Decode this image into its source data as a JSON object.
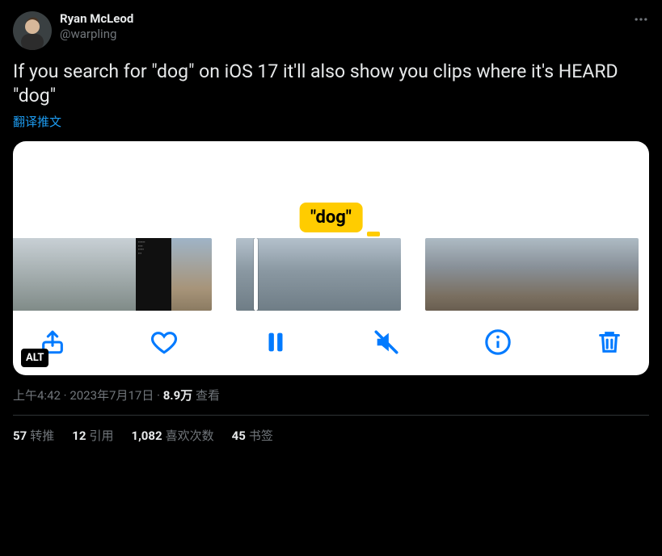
{
  "author": {
    "display_name": "Ryan McLeod",
    "handle": "@warpling"
  },
  "tweet_text": "If you search for \"dog\" on iOS 17 it'll also show you clips where it's HEARD \"dog\"",
  "translate_label": "翻译推文",
  "media": {
    "search_chip": "\"dog\"",
    "alt_badge": "ALT"
  },
  "timestamp": {
    "time": "上午4:42",
    "date": "2023年7月17日",
    "views_count": "8.9万",
    "views_label": "查看"
  },
  "stats": {
    "retweets_count": "57",
    "retweets_label": "转推",
    "quotes_count": "12",
    "quotes_label": "引用",
    "likes_count": "1,082",
    "likes_label": "喜欢次数",
    "bookmarks_count": "45",
    "bookmarks_label": "书签"
  }
}
